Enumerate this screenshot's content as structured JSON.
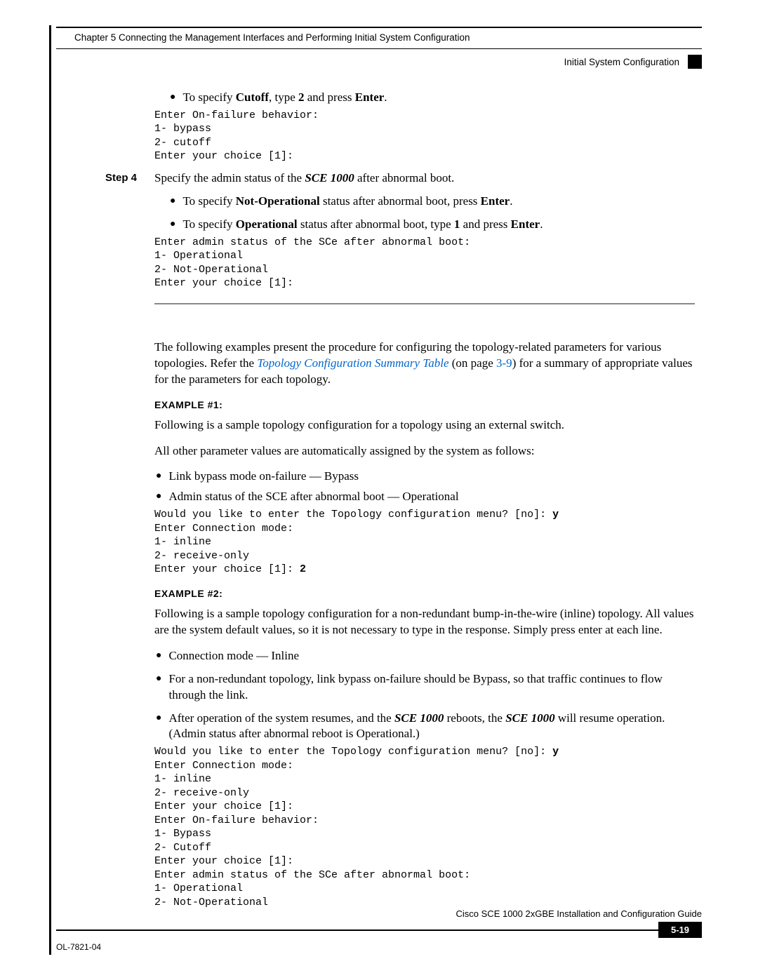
{
  "header": {
    "chapter": "Chapter 5      Connecting the Management Interfaces and Performing Initial System Configuration",
    "section": "Initial System Configuration"
  },
  "b1": {
    "pre": "To specify ",
    "s1": "Cutoff",
    "mid1": ", type ",
    "s2": "2",
    "mid2": " and press ",
    "s3": "Enter",
    "post": "."
  },
  "code1": "Enter On-failure behavior:\n1- bypass\n2- cutoff\nEnter your choice [1]:",
  "step4": {
    "label": "Step 4",
    "pre": "Specify the admin status of the ",
    "prod": "SCE 1000",
    "post": " after abnormal boot."
  },
  "b2": {
    "pre": "To specify ",
    "s1": "Not-Operational",
    "mid": " status after abnormal boot, press ",
    "s2": "Enter",
    "post": "."
  },
  "b3": {
    "pre": "To specify ",
    "s1": "Operational",
    "mid1": " status after abnormal boot, type ",
    "s2": "1",
    "mid2": " and press ",
    "s3": "Enter",
    "post": "."
  },
  "code2": "Enter admin status of the SCe after abnormal boot:\n1- Operational\n2- Not-Operational\nEnter your choice [1]:",
  "intro": {
    "p1a": "The following examples present the procedure for configuring the topology-related parameters for various topologies. Refer the ",
    "link": "Topology Configuration Summary Table",
    "p1b": " (on page ",
    "page": "3-9",
    "p1c": ") for a summary of appropriate values for the parameters for each topology."
  },
  "ex1": {
    "title": "EXAMPLE #1:",
    "p1": "Following is a sample topology configuration for a topology using an external switch.",
    "p2": "All other parameter values are automatically assigned by the system as follows:",
    "li1": "Link bypass mode on-failure — Bypass",
    "li2": "Admin status of the SCE after abnormal boot — Operational",
    "code_a": "Would you like to enter the Topology configuration menu? [no]: ",
    "code_y": "y",
    "code_b": "\nEnter Connection mode:\n1- inline\n2- receive-only\nEnter your choice [1]: ",
    "code_2": "2"
  },
  "ex2": {
    "title": "EXAMPLE #2:",
    "p1": "Following is a sample topology configuration for a non-redundant bump-in-the-wire (inline) topology. All values are the system default values, so it is not necessary to type in the response. Simply press enter at each line.",
    "li1": "Connection mode — Inline",
    "li2": "For a non-redundant topology, link bypass on-failure should be Bypass, so that traffic continues to flow through the link.",
    "li3a": "After operation of the system resumes, and the ",
    "prod1": "SCE 1000",
    "li3b": " reboots, the ",
    "prod2": "SCE 1000",
    "li3c": " will resume operation. (Admin status after abnormal reboot is Operational.)",
    "code_a": "Would you like to enter the Topology configuration menu? [no]: ",
    "code_y": "y",
    "code_b": "\nEnter Connection mode:\n1- inline\n2- receive-only\nEnter your choice [1]:\nEnter On-failure behavior:\n1- Bypass\n2- Cutoff\nEnter your choice [1]:\nEnter admin status of the SCe after abnormal boot:\n1- Operational\n2- Not-Operational"
  },
  "footer": {
    "guide": "Cisco SCE 1000 2xGBE Installation and Configuration Guide",
    "doc": "OL-7821-04",
    "page": "5-19"
  }
}
